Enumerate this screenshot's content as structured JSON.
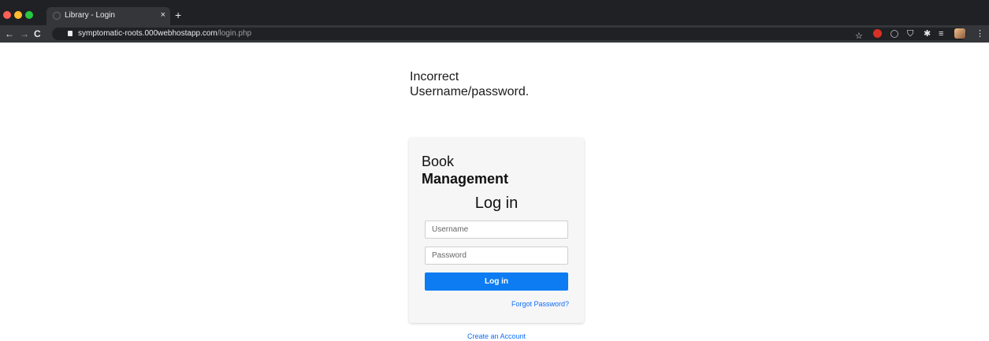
{
  "browser": {
    "tab_title": "Library - Login",
    "tab_close": "×",
    "new_tab": "+",
    "nav": {
      "back": "←",
      "forward": "→",
      "reload": "C"
    },
    "url_host": "symptomatic-roots.000webhostapp.com",
    "url_path": "/login.php",
    "extensions": {
      "star": "☆",
      "shield": "⛉",
      "puzzle": "✱",
      "list": "≡",
      "menu": "⋮"
    },
    "colors": {
      "tabbar": "#202124",
      "toolbar": "#35363a"
    }
  },
  "page": {
    "error_message": "Incorrect Username/password.",
    "brand_line1": "Book",
    "brand_line2": "Management",
    "login_title": "Log in",
    "username_placeholder": "Username",
    "password_placeholder": "Password",
    "login_button": "Log in",
    "forgot_password": "Forgot Password?",
    "create_account": "Create an Account",
    "colors": {
      "primary": "#0d7cf2",
      "link": "#0d6efd",
      "card": "#f6f6f6"
    }
  }
}
